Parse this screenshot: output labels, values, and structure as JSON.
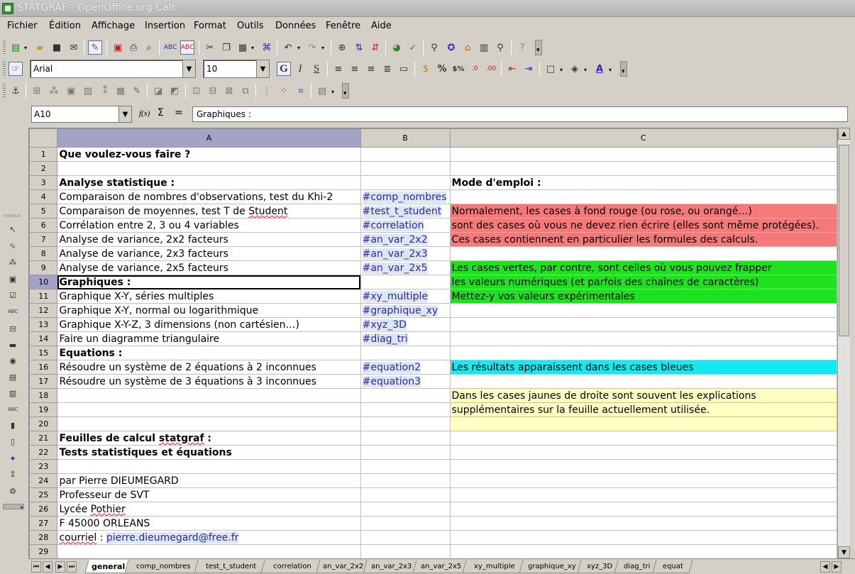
{
  "window": {
    "title": "STATGRAF - OpenOffice.org Calc"
  },
  "menu": [
    "Fichier",
    "Édition",
    "Affichage",
    "Insertion",
    "Format",
    "Outils",
    "Données",
    "Fenêtre",
    "Aide"
  ],
  "format_bar": {
    "font_name": "Arial",
    "font_size": "10",
    "bold_label": "G",
    "italic_label": "I",
    "underline_label": "S"
  },
  "formula_bar": {
    "cell_ref": "A10",
    "func_label": "f(x)",
    "sum_label": "Σ",
    "equals_label": "=",
    "content": "Graphiques :"
  },
  "columns": [
    "A",
    "B",
    "C"
  ],
  "selected_row": "10",
  "rows": [
    {
      "n": "1",
      "a": "Que voulez-vous faire ?",
      "b": "",
      "c": ""
    },
    {
      "n": "2",
      "a": "",
      "b": "",
      "c": ""
    },
    {
      "n": "3",
      "a": "Analyse statistique :",
      "b": "",
      "c": "Mode d'emploi :"
    },
    {
      "n": "4",
      "a": "Comparaison de nombres d'observations, test du Khi-2",
      "b": "#comp_nombres",
      "c": ""
    },
    {
      "n": "5",
      "a_pre": "Comparaison de moyennes, test T de ",
      "a_squig": "Student",
      "b": "#test_t_student",
      "c": "Normalement, les cases à fond rouge (ou rose, ou orangé…)"
    },
    {
      "n": "6",
      "a": "Corrélation entre 2, 3 ou 4 variables",
      "b": "#correlation",
      "c": "sont des cases où vous ne devez rien écrire (elles sont même protégées)."
    },
    {
      "n": "7",
      "a": "Analyse de variance, 2x2 facteurs",
      "b": "#an_var_2x2",
      "c": "Ces cases contiennent en particulier les formules des calculs."
    },
    {
      "n": "8",
      "a": "Analyse de variance, 2x3 facteurs",
      "b": "#an_var_2x3",
      "c": ""
    },
    {
      "n": "9",
      "a": "Analyse de variance, 2x5 facteurs",
      "b": "#an_var_2x5",
      "c": "Les cases vertes, par contre, sont celles où vous pouvez frapper"
    },
    {
      "n": "10",
      "a": "Graphiques :",
      "b": "",
      "c": "les valeurs numériques (et parfois des chaînes de caractères)"
    },
    {
      "n": "11",
      "a": "Graphique X-Y, séries multiples",
      "b": "#xy_multiple",
      "c": "Mettez-y vos valeurs expérimentales"
    },
    {
      "n": "12",
      "a": "Graphique X-Y, normal ou logarithmique",
      "b": "#graphique_xy",
      "c": ""
    },
    {
      "n": "13",
      "a": "Graphique X-Y-Z, 3 dimensions (non cartésien…)",
      "b": "#xyz_3D",
      "c": ""
    },
    {
      "n": "14",
      "a": "Faire un diagramme triangulaire",
      "b": "#diag_tri",
      "c": ""
    },
    {
      "n": "15",
      "a": "Equations :",
      "b": "",
      "c": ""
    },
    {
      "n": "16",
      "a": "Résoudre un système de 2 équations à 2 inconnues",
      "b": "#equation2",
      "c": "Les résultats apparaissent dans les cases bleues"
    },
    {
      "n": "17",
      "a": "Résoudre un système de 3 équations à 3 inconnues",
      "b": "#equation3",
      "c": ""
    },
    {
      "n": "18",
      "a": "",
      "b": "",
      "c": "Dans les cases jaunes de droite sont souvent les explications"
    },
    {
      "n": "19",
      "a": "",
      "b": "",
      "c": "supplémentaires sur la feuille actuellement utilisée."
    },
    {
      "n": "20",
      "a": "",
      "b": "",
      "c": ""
    },
    {
      "n": "21",
      "a_pre": "Feuilles de calcul ",
      "a_squig": "statgraf",
      "a_post": " :",
      "b": "",
      "c": ""
    },
    {
      "n": "22",
      "a": "Tests statistiques et équations",
      "b": "",
      "c": ""
    },
    {
      "n": "23",
      "a": "",
      "b": "",
      "c": ""
    },
    {
      "n": "24",
      "a": "par Pierre DIEUMEGARD",
      "b": "",
      "c": ""
    },
    {
      "n": "25",
      "a": "Professeur de SVT",
      "b": "",
      "c": ""
    },
    {
      "n": "26",
      "a_pre": "Lycée ",
      "a_squig": "Pothier",
      "b": "",
      "c": ""
    },
    {
      "n": "27",
      "a": "F 45000 ORLEANS",
      "b": "",
      "c": ""
    },
    {
      "n": "28",
      "a_squig": "courriel",
      "a_post": " : ",
      "a_link": "pierre.dieumegard@free.fr",
      "b": "",
      "c": ""
    },
    {
      "n": "29",
      "a": "",
      "b": "",
      "c": ""
    }
  ],
  "sheet_tabs": [
    "general",
    "comp_nombres",
    "test_t_student",
    "correlation",
    "an_var_2x2",
    "an_var_2x3",
    "an_var_2x5",
    "xy_multiple",
    "graphique_xy",
    "xyz_3D",
    "diag_tri",
    "equat"
  ],
  "active_tab": "general",
  "colors": {
    "red": "#f47a7a",
    "green": "#1fe11f",
    "cyan": "#14e8f0",
    "yellow": "#ffffc4",
    "link": "#2a2aa8"
  }
}
